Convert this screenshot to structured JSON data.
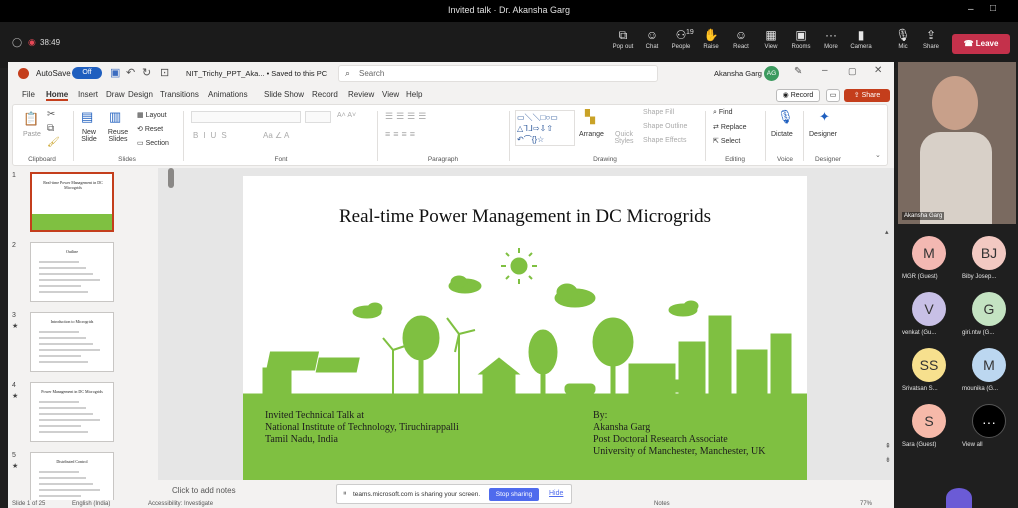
{
  "window": {
    "title": "Invited talk · Dr. Akansha Garg",
    "timer": "38:49"
  },
  "teams_toolbar": {
    "buttons": [
      {
        "label": "Pop out",
        "icon": "⧉"
      },
      {
        "label": "Chat",
        "icon": "☺"
      },
      {
        "label": "People",
        "icon": "⚇",
        "count": "19"
      },
      {
        "label": "Raise",
        "icon": "✋"
      },
      {
        "label": "React",
        "icon": "☺"
      },
      {
        "label": "View",
        "icon": "▦"
      },
      {
        "label": "Rooms",
        "icon": "▣"
      },
      {
        "label": "More",
        "icon": "···"
      },
      {
        "label": "Camera",
        "icon": "▮"
      },
      {
        "label": "Mic",
        "icon": "🎙"
      },
      {
        "label": "Share",
        "icon": "⇪"
      }
    ],
    "leave_label": "Leave"
  },
  "ppt": {
    "autosave_label": "AutoSave",
    "autosave_state": "Off",
    "filename": "NIT_Trichy_PPT_Aka... • Saved to this PC",
    "search_placeholder": "Search",
    "user_name": "Akansha Garg",
    "user_initials": "AG",
    "tabs": [
      "File",
      "Home",
      "Insert",
      "Draw",
      "Design",
      "Transitions",
      "Animations",
      "Slide Show",
      "Record",
      "Review",
      "View",
      "Help"
    ],
    "record_button": "Record",
    "share_button": "Share",
    "ribbon": {
      "clipboard": {
        "paste": "Paste",
        "label": "Clipboard"
      },
      "slides": {
        "new_slide": "New Slide",
        "reuse_slides": "Reuse Slides",
        "layout": "Layout",
        "reset": "Reset",
        "section": "Section",
        "label": "Slides"
      },
      "font": {
        "label": "Font"
      },
      "paragraph": {
        "label": "Paragraph"
      },
      "drawing": {
        "arrange": "Arrange",
        "quick_styles": "Quick Styles",
        "shape_fill": "Shape Fill",
        "shape_outline": "Shape Outline",
        "shape_effects": "Shape Effects",
        "label": "Drawing"
      },
      "editing": {
        "find": "Find",
        "replace": "Replace",
        "select": "Select",
        "label": "Editing"
      },
      "voice": {
        "dictate": "Dictate",
        "label": "Voice"
      },
      "designer": {
        "designer": "Designer",
        "label": "Designer"
      }
    },
    "thumbnails": [
      {
        "num": "1",
        "title": "Real-time Power Management in DC Microgrids",
        "selected": true
      },
      {
        "num": "2",
        "title": "Outline",
        "selected": false
      },
      {
        "num": "3",
        "title": "Introduction to Microgrids",
        "selected": false
      },
      {
        "num": "4",
        "title": "Power Management in DC Microgrids",
        "selected": false
      },
      {
        "num": "5",
        "title": "Distributed Control",
        "selected": false
      }
    ],
    "slide": {
      "title": "Real-time Power Management in DC Microgrids",
      "left_lines": [
        "Invited Technical Talk at",
        "National Institute of Technology, Tiruchirappalli",
        "Tamil Nadu, India"
      ],
      "right_lines": [
        "By:",
        "Akansha Garg",
        "Post Doctoral Research Associate",
        "University of Manchester, Manchester, UK"
      ]
    },
    "notes_placeholder": "Click to add notes",
    "status": {
      "slide_of": "Slide 1 of 25",
      "language": "English (India)",
      "accessibility": "Accessibility: Investigate",
      "notes": "Notes",
      "zoom": "77%"
    }
  },
  "share_banner": {
    "text": "teams.microsoft.com is sharing your screen.",
    "stop": "Stop sharing",
    "hide": "Hide"
  },
  "presenter": {
    "name": "Akansha Garg"
  },
  "participants": [
    {
      "initials": "M",
      "name": "MGR (Guest)",
      "color": "#f3b8b2"
    },
    {
      "initials": "BJ",
      "name": "Biby Josep...",
      "color": "#f2c9c2"
    },
    {
      "initials": "V",
      "name": "venkat (Gu...",
      "color": "#c8c0e6"
    },
    {
      "initials": "G",
      "name": "giri.ntw (G...",
      "color": "#c4e3c2"
    },
    {
      "initials": "SS",
      "name": "Srivatsan S...",
      "color": "#f7e08e"
    },
    {
      "initials": "M",
      "name": "mounika (G...",
      "color": "#bcd7f0"
    },
    {
      "initials": "S",
      "name": "Sara (Guest)",
      "color": "#f6b9a9"
    },
    {
      "initials": "···",
      "name": "View all",
      "color": "#000000"
    }
  ],
  "colors": {
    "ppt_accent": "#c43e1c",
    "teams_leave": "#c4314b",
    "stop_sharing": "#4f6bed",
    "slide_green": "#7fc041"
  }
}
